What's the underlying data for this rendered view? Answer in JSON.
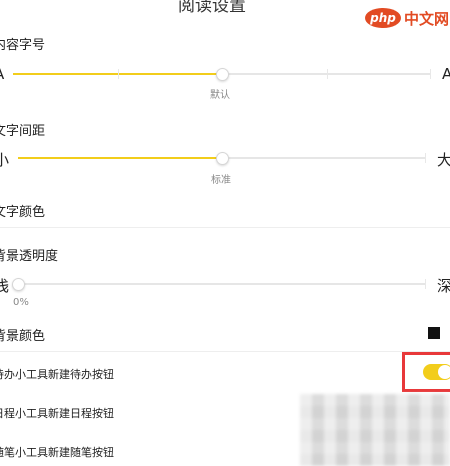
{
  "header": {
    "title": "阅读设置"
  },
  "watermark": {
    "badge": "php",
    "text": "中文网"
  },
  "font_size": {
    "label": "内容字号",
    "min_label": "A",
    "max_label": "A",
    "caption": "默认",
    "value_fraction": 0.5
  },
  "line_spacing": {
    "label": "文字间距",
    "min_label": "小",
    "max_label": "大",
    "caption": "标准",
    "value_fraction": 0.5
  },
  "text_color": {
    "label": "文字颜色"
  },
  "bg_opacity": {
    "label": "背景透明度",
    "min_label": "浅",
    "max_label": "深",
    "caption": "0%",
    "value_fraction": 0.0
  },
  "bg_color": {
    "label": "背景颜色",
    "swatch_color": "#111111"
  },
  "toggles": [
    {
      "label": "待办小工具新建待办按钮",
      "on": true
    },
    {
      "label": "日程小工具新建日程按钮"
    },
    {
      "label": "随笔小工具新建随笔按钮"
    }
  ],
  "colors": {
    "accent": "#f2cd1b",
    "highlight": "#e8383a",
    "logo": "#e24b23"
  }
}
